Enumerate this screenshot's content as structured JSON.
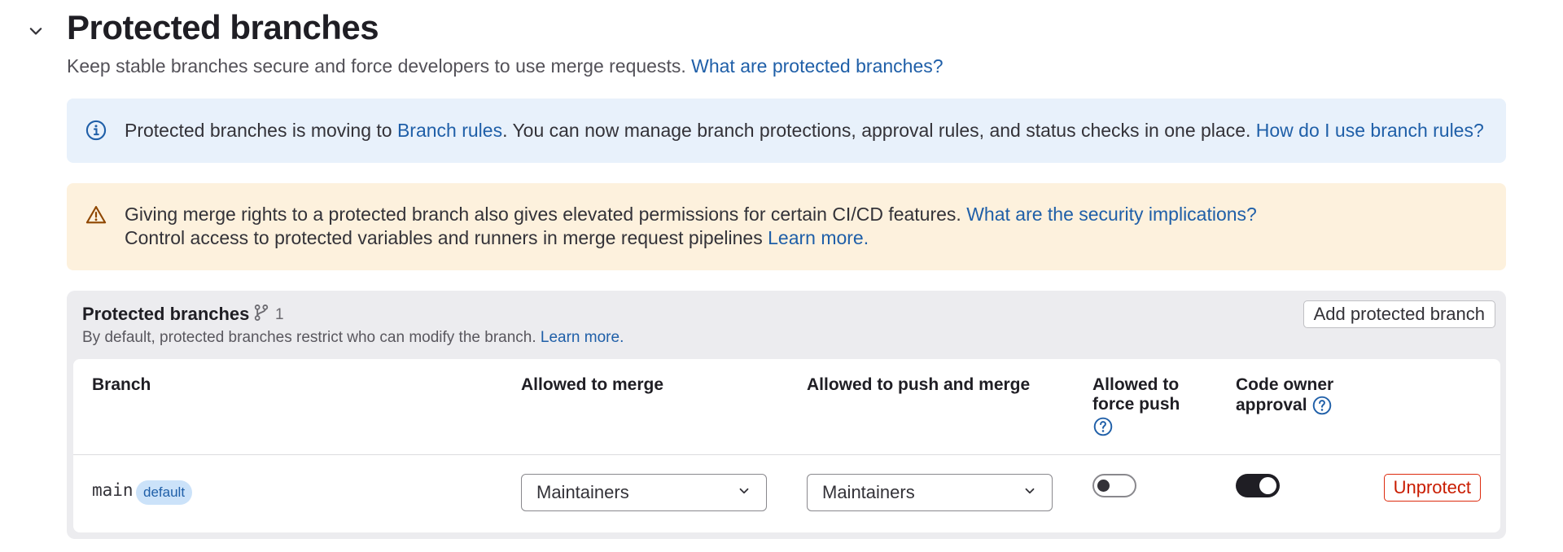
{
  "header": {
    "title": "Protected branches",
    "subtitle": "Keep stable branches secure and force developers to use merge requests.",
    "subtitle_link": "What are protected branches?"
  },
  "info_alert": {
    "icon": "info-icon",
    "text_before": "Protected branches is moving to ",
    "link1": "Branch rules",
    "text_after": ". You can now manage branch protections, approval rules, and status checks in one place.",
    "link2": "How do I use branch rules?"
  },
  "warning_alert": {
    "icon": "warning-icon",
    "line1": "Giving merge rights to a protected branch also gives elevated permissions for certain CI/CD features.",
    "line1_link": "What are the security implications?",
    "line2": "Control access to protected variables and runners in merge request pipelines",
    "line2_link": "Learn more."
  },
  "card": {
    "title": "Protected branches",
    "count_icon": "branch-icon",
    "count": "1",
    "description": "By default, protected branches restrict who can modify the branch.",
    "description_link": "Learn more.",
    "add_button": "Add protected branch"
  },
  "table": {
    "headers": {
      "branch": "Branch",
      "allowed_merge": "Allowed to merge",
      "allowed_push_merge": "Allowed to push and merge",
      "force_push_line1": "Allowed to",
      "force_push_line2": "force push",
      "code_owner_line1": "Code owner",
      "code_owner_line2": "approval"
    },
    "rows": [
      {
        "branch": "main",
        "badge": "default",
        "allowed_merge": "Maintainers",
        "allowed_push_merge": "Maintainers",
        "force_push": false,
        "code_owner_approval": true,
        "action": "Unprotect"
      }
    ]
  },
  "colors": {
    "link": "#1f5fa8",
    "info_bg": "#e8f1fb",
    "warning_bg": "#fdf1dd",
    "danger": "#dd2b0e"
  }
}
